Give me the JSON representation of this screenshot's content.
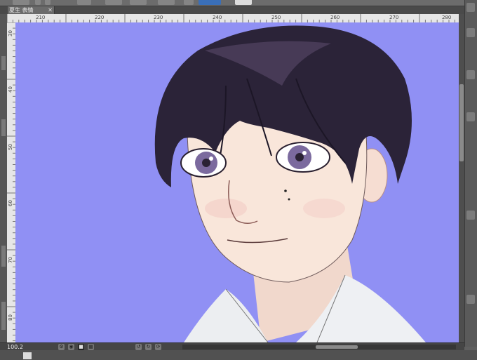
{
  "document_tab": {
    "title": "夏生 表情",
    "close_glyph": "✕"
  },
  "ruler_top_labels": [
    "210",
    "220",
    "230",
    "240",
    "250",
    "260",
    "270",
    "280"
  ],
  "ruler_left_labels": [
    "30",
    "40",
    "50",
    "60",
    "70",
    "80"
  ],
  "status": {
    "zoom": "100.2"
  },
  "colors": {
    "canvas_background": "#9090f4",
    "hair": "#2b2338",
    "skin": "#f7e3d8",
    "iris": "#7b6a9e",
    "shirt": "#f0f1f3"
  },
  "icons": [
    "settings-icon",
    "eye-icon",
    "rotate-icon",
    "layer-icon",
    "grid-icon"
  ]
}
